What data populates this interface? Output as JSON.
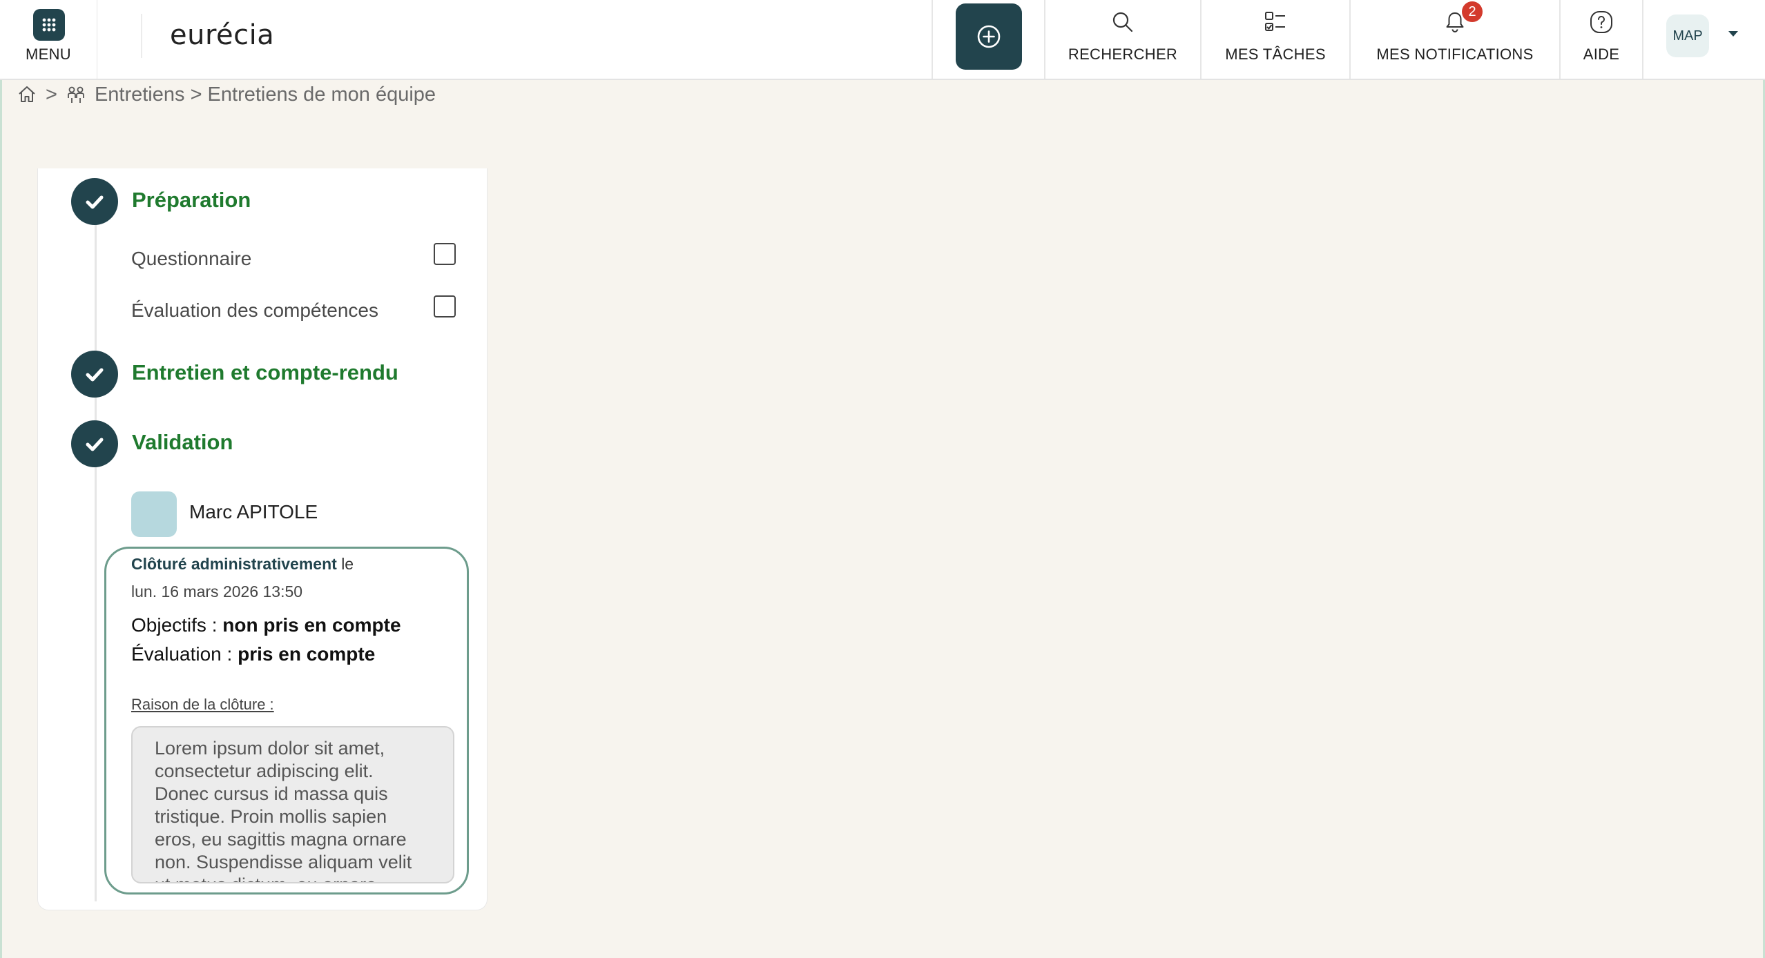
{
  "topbar": {
    "menu_label": "MENU",
    "logo_text": "eurécia",
    "search_label": "RECHERCHER",
    "tasks_label": "MES TÂCHES",
    "notifications_label": "MES NOTIFICATIONS",
    "notifications_count": "2",
    "help_label": "AIDE",
    "user_initials": "MAP"
  },
  "breadcrumb": {
    "separator": ">",
    "path": "Entretiens > Entretiens de mon équipe"
  },
  "steps": {
    "preparation": {
      "title": "Préparation",
      "items": [
        {
          "label": "Questionnaire",
          "checked": false
        },
        {
          "label": "Évaluation des compétences",
          "checked": false
        }
      ]
    },
    "entretien": {
      "title": "Entretien et compte-rendu"
    },
    "validation": {
      "title": "Validation",
      "person_name": "Marc APITOLE",
      "closure": {
        "status": "Clôturé administrativement",
        "status_suffix": "le",
        "date": "lun. 16 mars 2026 13:50",
        "objectifs_label": "Objectifs : ",
        "objectifs_value": "non pris en compte",
        "evaluation_label": "Évaluation : ",
        "evaluation_value": "pris en compte",
        "reason_label": "Raison de la clôture :",
        "reason_text": "Lorem ipsum dolor sit amet, consectetur adipiscing elit. Donec cursus id massa quis tristique. Proin mollis sapien eros, eu sagittis magna ornare non. Suspendisse aliquam velit ut metus dictum, eu ornare"
      }
    }
  },
  "colors": {
    "primary": "#22444d",
    "step_title": "#1f7a2e",
    "badge": "#d33a2c",
    "card_border": "#6d9c8c",
    "background": "#f7f4ee"
  }
}
